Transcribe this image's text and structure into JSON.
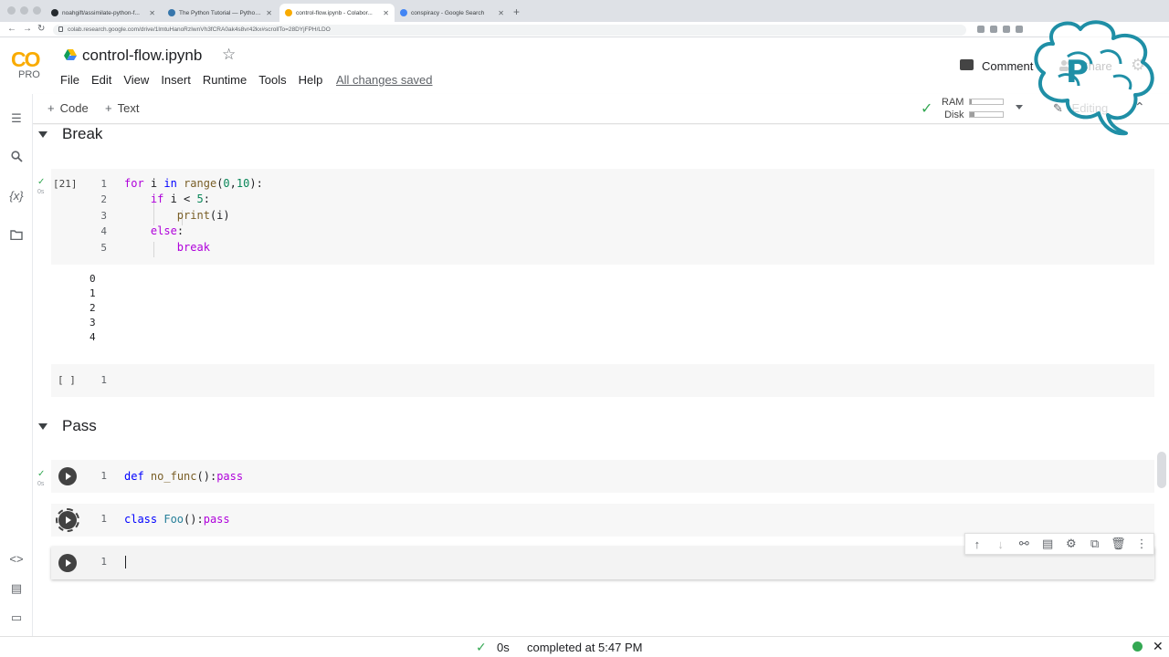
{
  "browser": {
    "tabs": [
      {
        "label": "noahgift/assimilate-python-f..."
      },
      {
        "label": "The Python Tutorial — Python ..."
      },
      {
        "label": "control-flow.ipynb - Colabor..."
      },
      {
        "label": "conspiracy - Google Search"
      }
    ],
    "url": "colab.research.google.com/drive/1lmtuHanoRzIwnVh3fCRA0ak4s8vr42kx#scrollTo=28DYjFPH/LDO"
  },
  "colab": {
    "logo": "CO",
    "tier": "PRO",
    "notebook_title": "control-flow.ipynb",
    "menu": [
      "File",
      "Edit",
      "View",
      "Insert",
      "Runtime",
      "Tools",
      "Help"
    ],
    "save_status": "All changes saved",
    "comment_label": "Comment",
    "share_label": "Share"
  },
  "toolbar": {
    "add_code": "Code",
    "add_text": "Text",
    "ram_label": "RAM",
    "disk_label": "Disk",
    "ram_usage": 0.05,
    "disk_usage": 0.15,
    "mode_label": "Editing"
  },
  "sections": [
    {
      "title": "Break"
    },
    {
      "title": "Pass"
    }
  ],
  "cells": {
    "break_cell": {
      "exec_count": "[21]",
      "duration": "0s",
      "line_numbers": [
        "1",
        "2",
        "3",
        "4",
        "5"
      ],
      "output": [
        "0",
        "1",
        "2",
        "3",
        "4"
      ]
    },
    "empty_cell": {
      "exec_count": "[ ]",
      "line_number": "1"
    },
    "pass_func_cell": {
      "duration": "0s",
      "line_number": "1"
    },
    "pass_class_cell": {
      "line_number": "1"
    },
    "active_cell": {
      "line_number": "1"
    }
  },
  "status": {
    "duration": "0s",
    "message": "completed at 5:47 PM"
  },
  "colors": {
    "accent_green": "#34a853",
    "logo_orange": "#f9ab00",
    "keyword_blue": "#0000ff",
    "control_purple": "#af00db",
    "number_green": "#098658"
  }
}
